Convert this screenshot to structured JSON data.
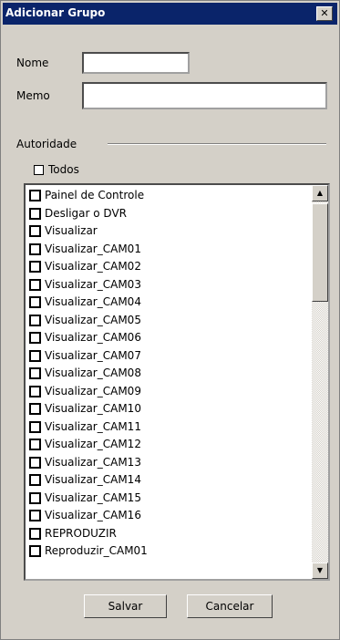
{
  "window": {
    "title": "Adicionar Grupo",
    "close_icon_glyph": "✕"
  },
  "form": {
    "nome_label": "Nome",
    "nome_value": "",
    "memo_label": "Memo",
    "memo_value": "",
    "autoridade_label": "Autoridade",
    "todos_label": "Todos",
    "todos_checked": false
  },
  "permissions": [
    "Painel de Controle",
    "Desligar o DVR",
    "Visualizar",
    "Visualizar_CAM01",
    "Visualizar_CAM02",
    "Visualizar_CAM03",
    "Visualizar_CAM04",
    "Visualizar_CAM05",
    "Visualizar_CAM06",
    "Visualizar_CAM07",
    "Visualizar_CAM08",
    "Visualizar_CAM09",
    "Visualizar_CAM10",
    "Visualizar_CAM11",
    "Visualizar_CAM12",
    "Visualizar_CAM13",
    "Visualizar_CAM14",
    "Visualizar_CAM15",
    "Visualizar_CAM16",
    "REPRODUZIR",
    "Reproduzir_CAM01"
  ],
  "buttons": {
    "save_label": "Salvar",
    "cancel_label": "Cancelar"
  },
  "colors": {
    "titlebar": "#0a246a",
    "window_bg": "#d4d0c8"
  }
}
